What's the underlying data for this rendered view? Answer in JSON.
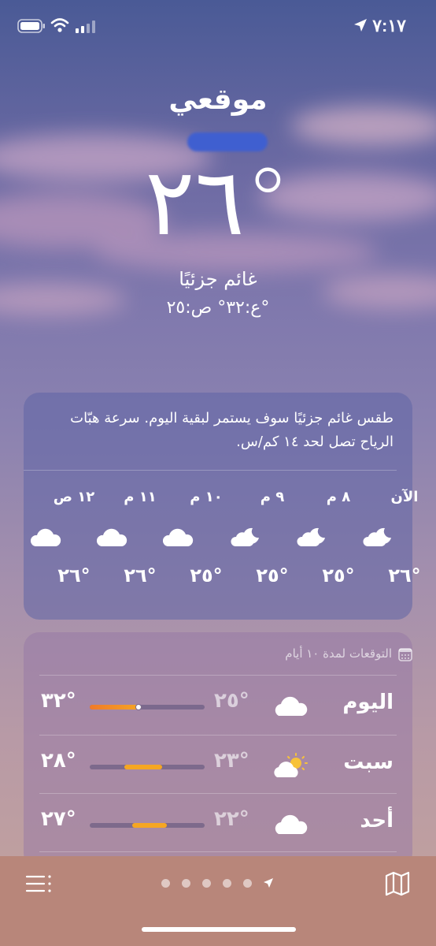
{
  "status_bar": {
    "time": "٧:١٧",
    "icons": [
      "location-arrow-icon",
      "battery-icon",
      "wifi-icon",
      "signal-icon"
    ]
  },
  "header": {
    "location": "موقعي",
    "temperature": "٢٦°",
    "condition": "غائم جزئيًا",
    "high_low": "ع:٣٢°  ص:٢٥°"
  },
  "hourly_card": {
    "summary": "طقس غائم جزئيًا سوف يستمر لبقية اليوم. سرعة هبّات الرياح تصل لحد ١٤ كم/س.",
    "hours": [
      {
        "label": "الآن",
        "icon": "cloud-moon-icon",
        "temp": "٢٦°"
      },
      {
        "label": "٨ م",
        "icon": "cloud-moon-icon",
        "temp": "٢٥°"
      },
      {
        "label": "٩ م",
        "icon": "cloud-moon-icon",
        "temp": "٢٥°"
      },
      {
        "label": "١٠ م",
        "icon": "cloud-icon",
        "temp": "٢٥°"
      },
      {
        "label": "١١ م",
        "icon": "cloud-icon",
        "temp": "٢٦°"
      },
      {
        "label": "١٢ ص",
        "icon": "cloud-icon",
        "temp": "٢٦°"
      }
    ]
  },
  "forecast_card": {
    "title": "التوقعات لمدة ١٠ أيام",
    "days": [
      {
        "day": "اليوم",
        "icon": "cloud-icon",
        "low": "٢٥°",
        "high": "٣٢°"
      },
      {
        "day": "سبت",
        "icon": "sun-cloud-icon",
        "low": "٢٣°",
        "high": "٢٨°"
      },
      {
        "day": "أحد",
        "icon": "cloud-icon",
        "low": "٢٢°",
        "high": "٢٧°"
      }
    ],
    "colors": {
      "warm": "#f5a623",
      "hot": "#f07a2a",
      "track": "#5f5478"
    }
  },
  "bottom_bar": {
    "icons": [
      "list-icon",
      "map-icon",
      "location-arrow-icon"
    ],
    "page_count": 5
  }
}
